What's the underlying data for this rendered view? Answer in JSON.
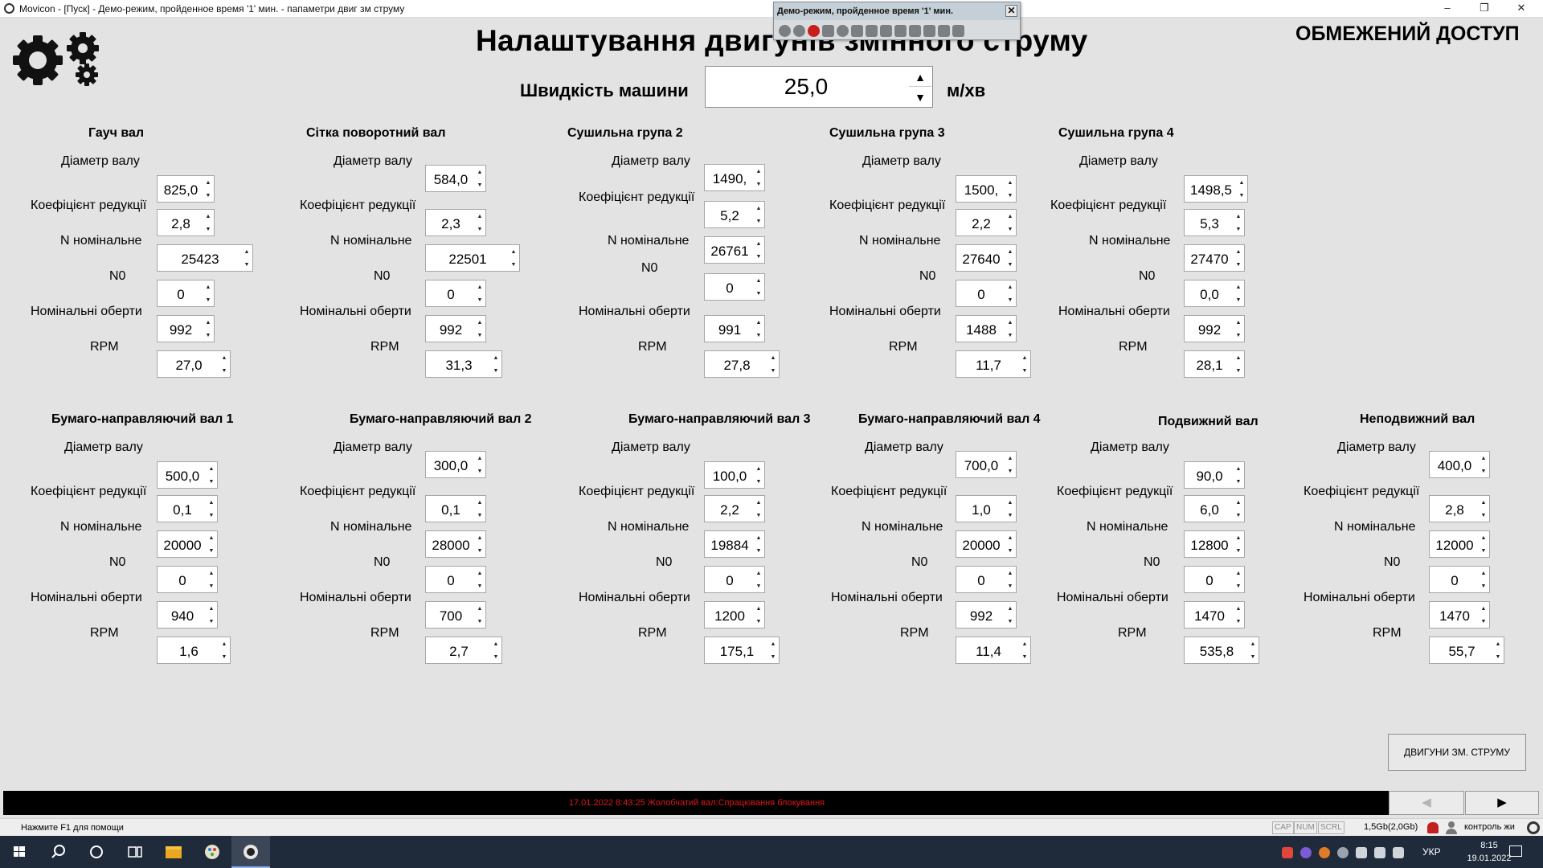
{
  "window": {
    "title": "Movicon - [Пуск] - Демо-режим, пройденное время '1' мин. - папаметри двиг зм струму",
    "minimize": "–",
    "restore": "❐",
    "close": "✕"
  },
  "demo_window": {
    "title": "Демо-режим, пройденное время '1' мин.",
    "close": "✕",
    "tools": [
      "play-icon",
      "pause-icon",
      "stop-icon",
      "lightning-icon",
      "chart-icon",
      "grid-icon",
      "list-icon",
      "document-icon",
      "picture-icon",
      "database-icon",
      "export-icon",
      "monitor-icon",
      "trash-icon"
    ]
  },
  "header": {
    "title": "Налаштування двигунів змінного струму",
    "restricted": "ОБМЕЖЕНИЙ ДОСТУП",
    "speed_label": "Швидкість машини",
    "speed_value": "25,0",
    "speed_unit": "м/хв",
    "logo_icon": "gears-icon"
  },
  "labels": {
    "diameter": "Діаметр валу",
    "reduction": "Коефіцієнт редукції",
    "n_nominal": "N номінальне",
    "n0": "N0",
    "nominal_rpm": "Номінальні оберти",
    "rpm": "RPM"
  },
  "groups": [
    {
      "title": "Гауч вал",
      "diameter": "825,0",
      "reduction": "2,8",
      "n_nominal": "25423",
      "n0": "0",
      "nominal_rpm": "992",
      "rpm": "27,0"
    },
    {
      "title": "Сітка поворотний вал",
      "diameter": "584,0",
      "reduction": "2,3",
      "n_nominal": "22501",
      "n0": "0",
      "nominal_rpm": "992",
      "rpm": "31,3"
    },
    {
      "title": "Сушильна група 2",
      "diameter": "1490,",
      "reduction": "5,2",
      "n_nominal": "26761",
      "n0": "0",
      "nominal_rpm": "991",
      "rpm": "27,8"
    },
    {
      "title": "Сушильна група 3",
      "diameter": "1500,",
      "reduction": "2,2",
      "n_nominal": "27640",
      "n0": "0",
      "nominal_rpm": "1488",
      "rpm": "11,7"
    },
    {
      "title": "Сушильна група 4",
      "diameter": "1498,5",
      "reduction": "5,3",
      "n_nominal": "27470",
      "n0": "0,0",
      "nominal_rpm": "992",
      "rpm": "28,1"
    },
    {
      "title": "Бумаго-направляючий вал 1",
      "diameter": "500,0",
      "reduction": "0,1",
      "n_nominal": "20000",
      "n0": "0",
      "nominal_rpm": "940",
      "rpm": "1,6"
    },
    {
      "title": "Бумаго-направляючий вал 2",
      "diameter": "300,0",
      "reduction": "0,1",
      "n_nominal": "28000",
      "n0": "0",
      "nominal_rpm": "700",
      "rpm": "2,7"
    },
    {
      "title": "Бумаго-направляючий вал 3",
      "diameter": "100,0",
      "reduction": "2,2",
      "n_nominal": "19884",
      "n0": "0",
      "nominal_rpm": "1200",
      "rpm": "175,1"
    },
    {
      "title": "Бумаго-направляючий вал 4",
      "diameter": "700,0",
      "reduction": "1,0",
      "n_nominal": "20000",
      "n0": "0",
      "nominal_rpm": "992",
      "rpm": "11,4"
    },
    {
      "title": "Подвижний вал",
      "diameter": "90,0",
      "reduction": "6,0",
      "n_nominal": "12800",
      "n0": "0",
      "nominal_rpm": "1470",
      "rpm": "535,8"
    },
    {
      "title": "Неподвижний вал",
      "diameter": "400,0",
      "reduction": "2,8",
      "n_nominal": "12000",
      "n0": "0",
      "nominal_rpm": "1470",
      "rpm": "55,7"
    }
  ],
  "button_ac_motors": "ДВИГУНИ ЗМ. СТРУМУ",
  "alarm": {
    "text": "17.01.2022 8:43:25 Жолобчатий вал:Спрацювання блокування",
    "color": "#e01818"
  },
  "nav": {
    "prev": "◀",
    "next": "▶"
  },
  "statusbar": {
    "help": "Нажмите F1 для помощи",
    "cap": "CAP",
    "num": "NUM",
    "scrl": "SCRL",
    "memory": "1,5Gb(2,0Gb)",
    "user": "контроль жи"
  },
  "taskbar": {
    "lang": "УКР",
    "time": "8:15",
    "date": "19.01.2022"
  }
}
